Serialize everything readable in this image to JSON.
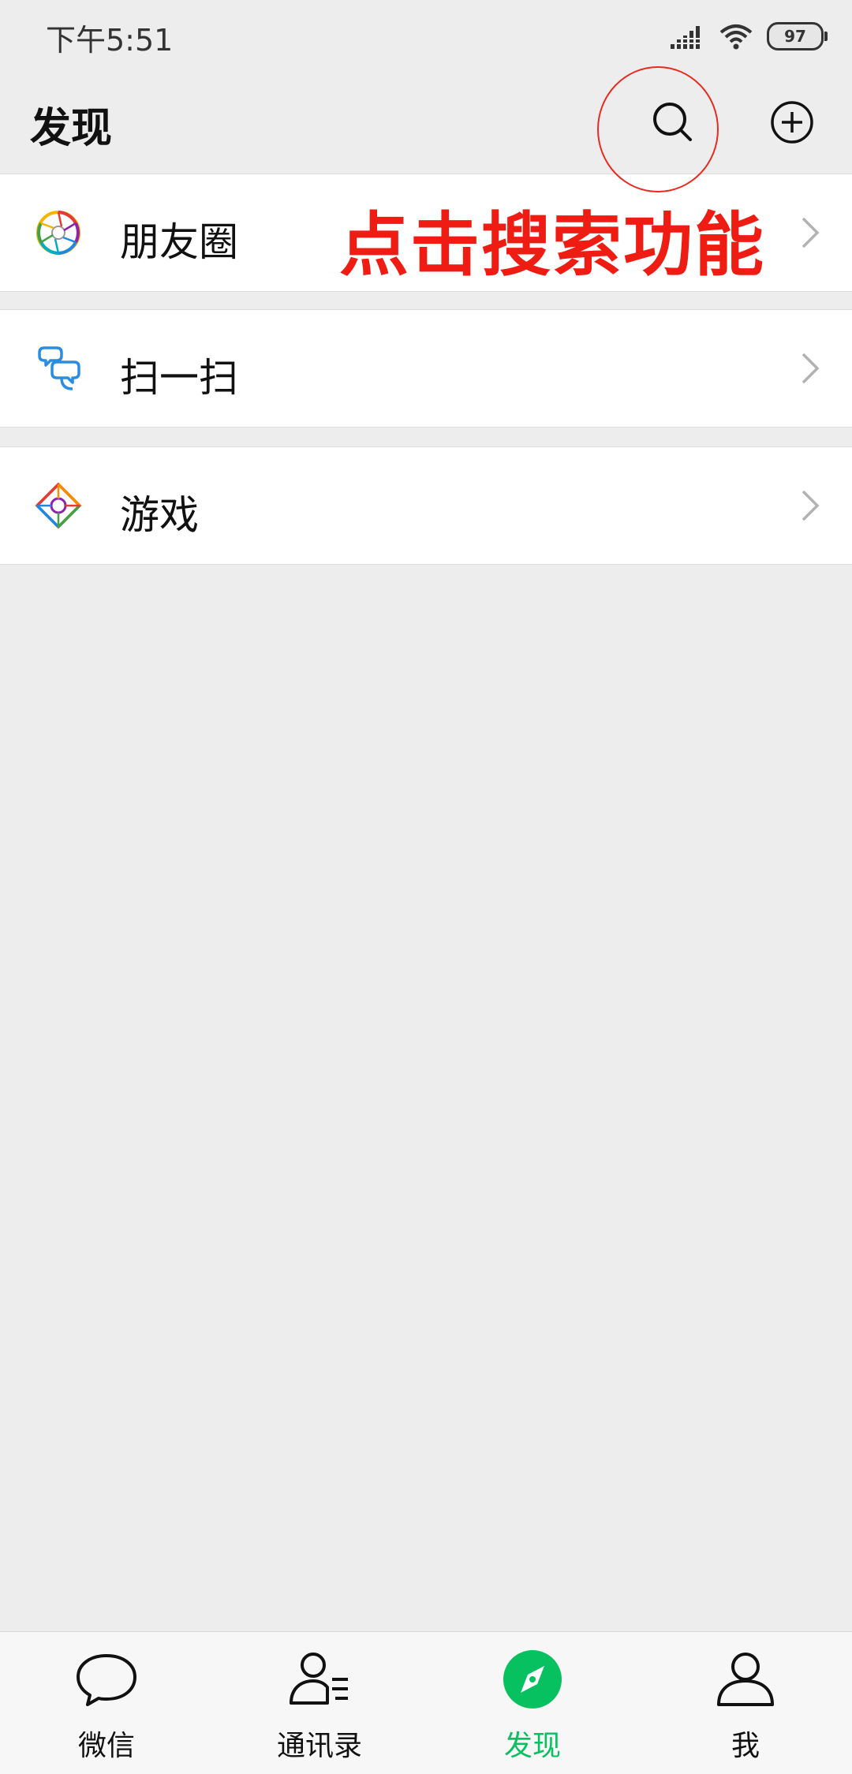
{
  "status_bar": {
    "time": "下午5:51",
    "battery": "97"
  },
  "header": {
    "title": "发现"
  },
  "annotation": {
    "text": "点击搜索功能"
  },
  "menu": [
    {
      "label": "朋友圈",
      "icon": "moments-icon"
    },
    {
      "label": "扫一扫",
      "icon": "scan-icon"
    },
    {
      "label": "游戏",
      "icon": "game-icon"
    }
  ],
  "tab_bar": {
    "tabs": [
      {
        "label": "微信",
        "icon": "chat-bubble-icon",
        "active": false
      },
      {
        "label": "通讯录",
        "icon": "contacts-icon",
        "active": false
      },
      {
        "label": "发现",
        "icon": "compass-icon",
        "active": true
      },
      {
        "label": "我",
        "icon": "person-icon",
        "active": false
      }
    ]
  },
  "colors": {
    "accent": "#07c160",
    "annotation": "#ee1c12",
    "background": "#ededed"
  }
}
